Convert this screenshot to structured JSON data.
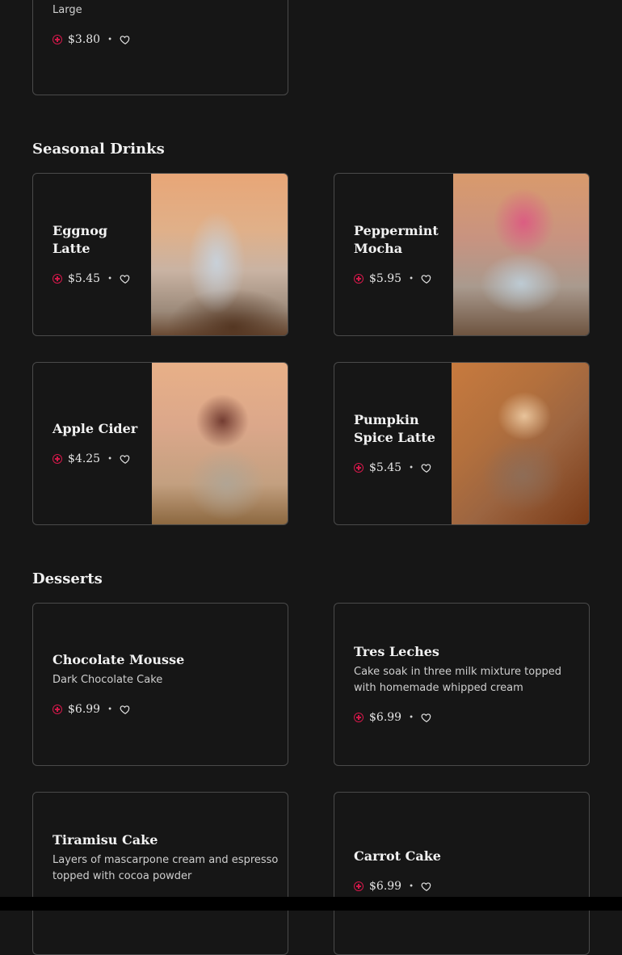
{
  "top_card": {
    "subtitle": "Large",
    "price": "$3.80"
  },
  "sections": {
    "seasonal": {
      "title": "Seasonal Drinks",
      "items": [
        {
          "name_l1": "Eggnog",
          "name_l2": "Latte",
          "price": "$5.45"
        },
        {
          "name_l1": "Peppermint",
          "name_l2": "Mocha",
          "price": "$5.95"
        },
        {
          "name": "Apple Cider",
          "price": "$4.25"
        },
        {
          "name_l1": "Pumpkin",
          "name_l2": "Spice Latte",
          "price": "$5.45"
        }
      ]
    },
    "desserts": {
      "title": "Desserts",
      "items": [
        {
          "name": "Chocolate Mousse",
          "desc": "Dark Chocolate Cake",
          "price": "$6.99"
        },
        {
          "name": "Tres Leches",
          "desc_l1": "Cake soak in three milk mixture topped",
          "desc_l2": "with homemade whipped cream",
          "price": "$6.99"
        },
        {
          "name": "Tiramisu Cake",
          "desc_l1": "Layers of mascarpone cream and espresso",
          "desc_l2": "topped with cocoa powder"
        },
        {
          "name": "Carrot Cake",
          "price": "$6.99"
        }
      ]
    }
  },
  "dot": "•",
  "icons": {
    "add": "plus-circle-icon",
    "favorite": "heart-outline-icon"
  },
  "colors": {
    "background": "#161616",
    "accent": "#d4184a",
    "border": "#4a4a4a"
  }
}
